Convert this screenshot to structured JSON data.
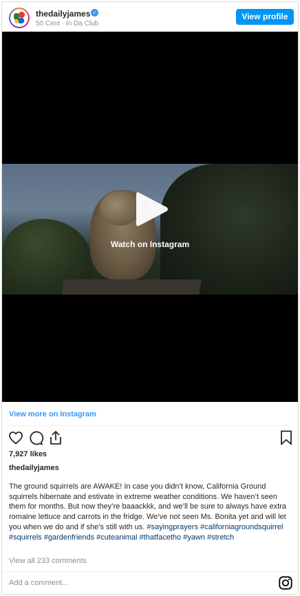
{
  "header": {
    "username": "thedailyjames",
    "subtitle": "50 Cent · In Da Club",
    "view_profile_label": "View profile",
    "verified_mark": "✓"
  },
  "video": {
    "watch_label": "Watch on Instagram"
  },
  "view_more_label": "View more on Instagram",
  "actions": {
    "icons": [
      "heart-icon",
      "comment-icon",
      "share-icon",
      "bookmark-icon"
    ]
  },
  "likes": "7,927 likes",
  "caption": {
    "username": "thedailyjames",
    "text": "The ground squirrels are AWAKE! In case you didn’t know, California Ground squirrels hibernate and estivate in extreme weather conditions. We haven’t seen them for months. But now they’re baaackkk, and we’ll be sure to always have extra romaine lettuce and carrots in the fridge. We’ve not seen Ms. Bonita yet and will let you when we do and if she’s still with us. ",
    "hashtags": "#sayingprayers #californiagroundsquirrel #squirrels #gardenfriends #cuteanimal #thatfacetho #yawn #stretch"
  },
  "view_comments_label": "View all 233 comments",
  "comment_placeholder": "Add a comment...",
  "colors": {
    "accent": "#3897f0",
    "button": "#0095f6",
    "hashtag": "#00376b",
    "muted": "#8e8e8e"
  }
}
